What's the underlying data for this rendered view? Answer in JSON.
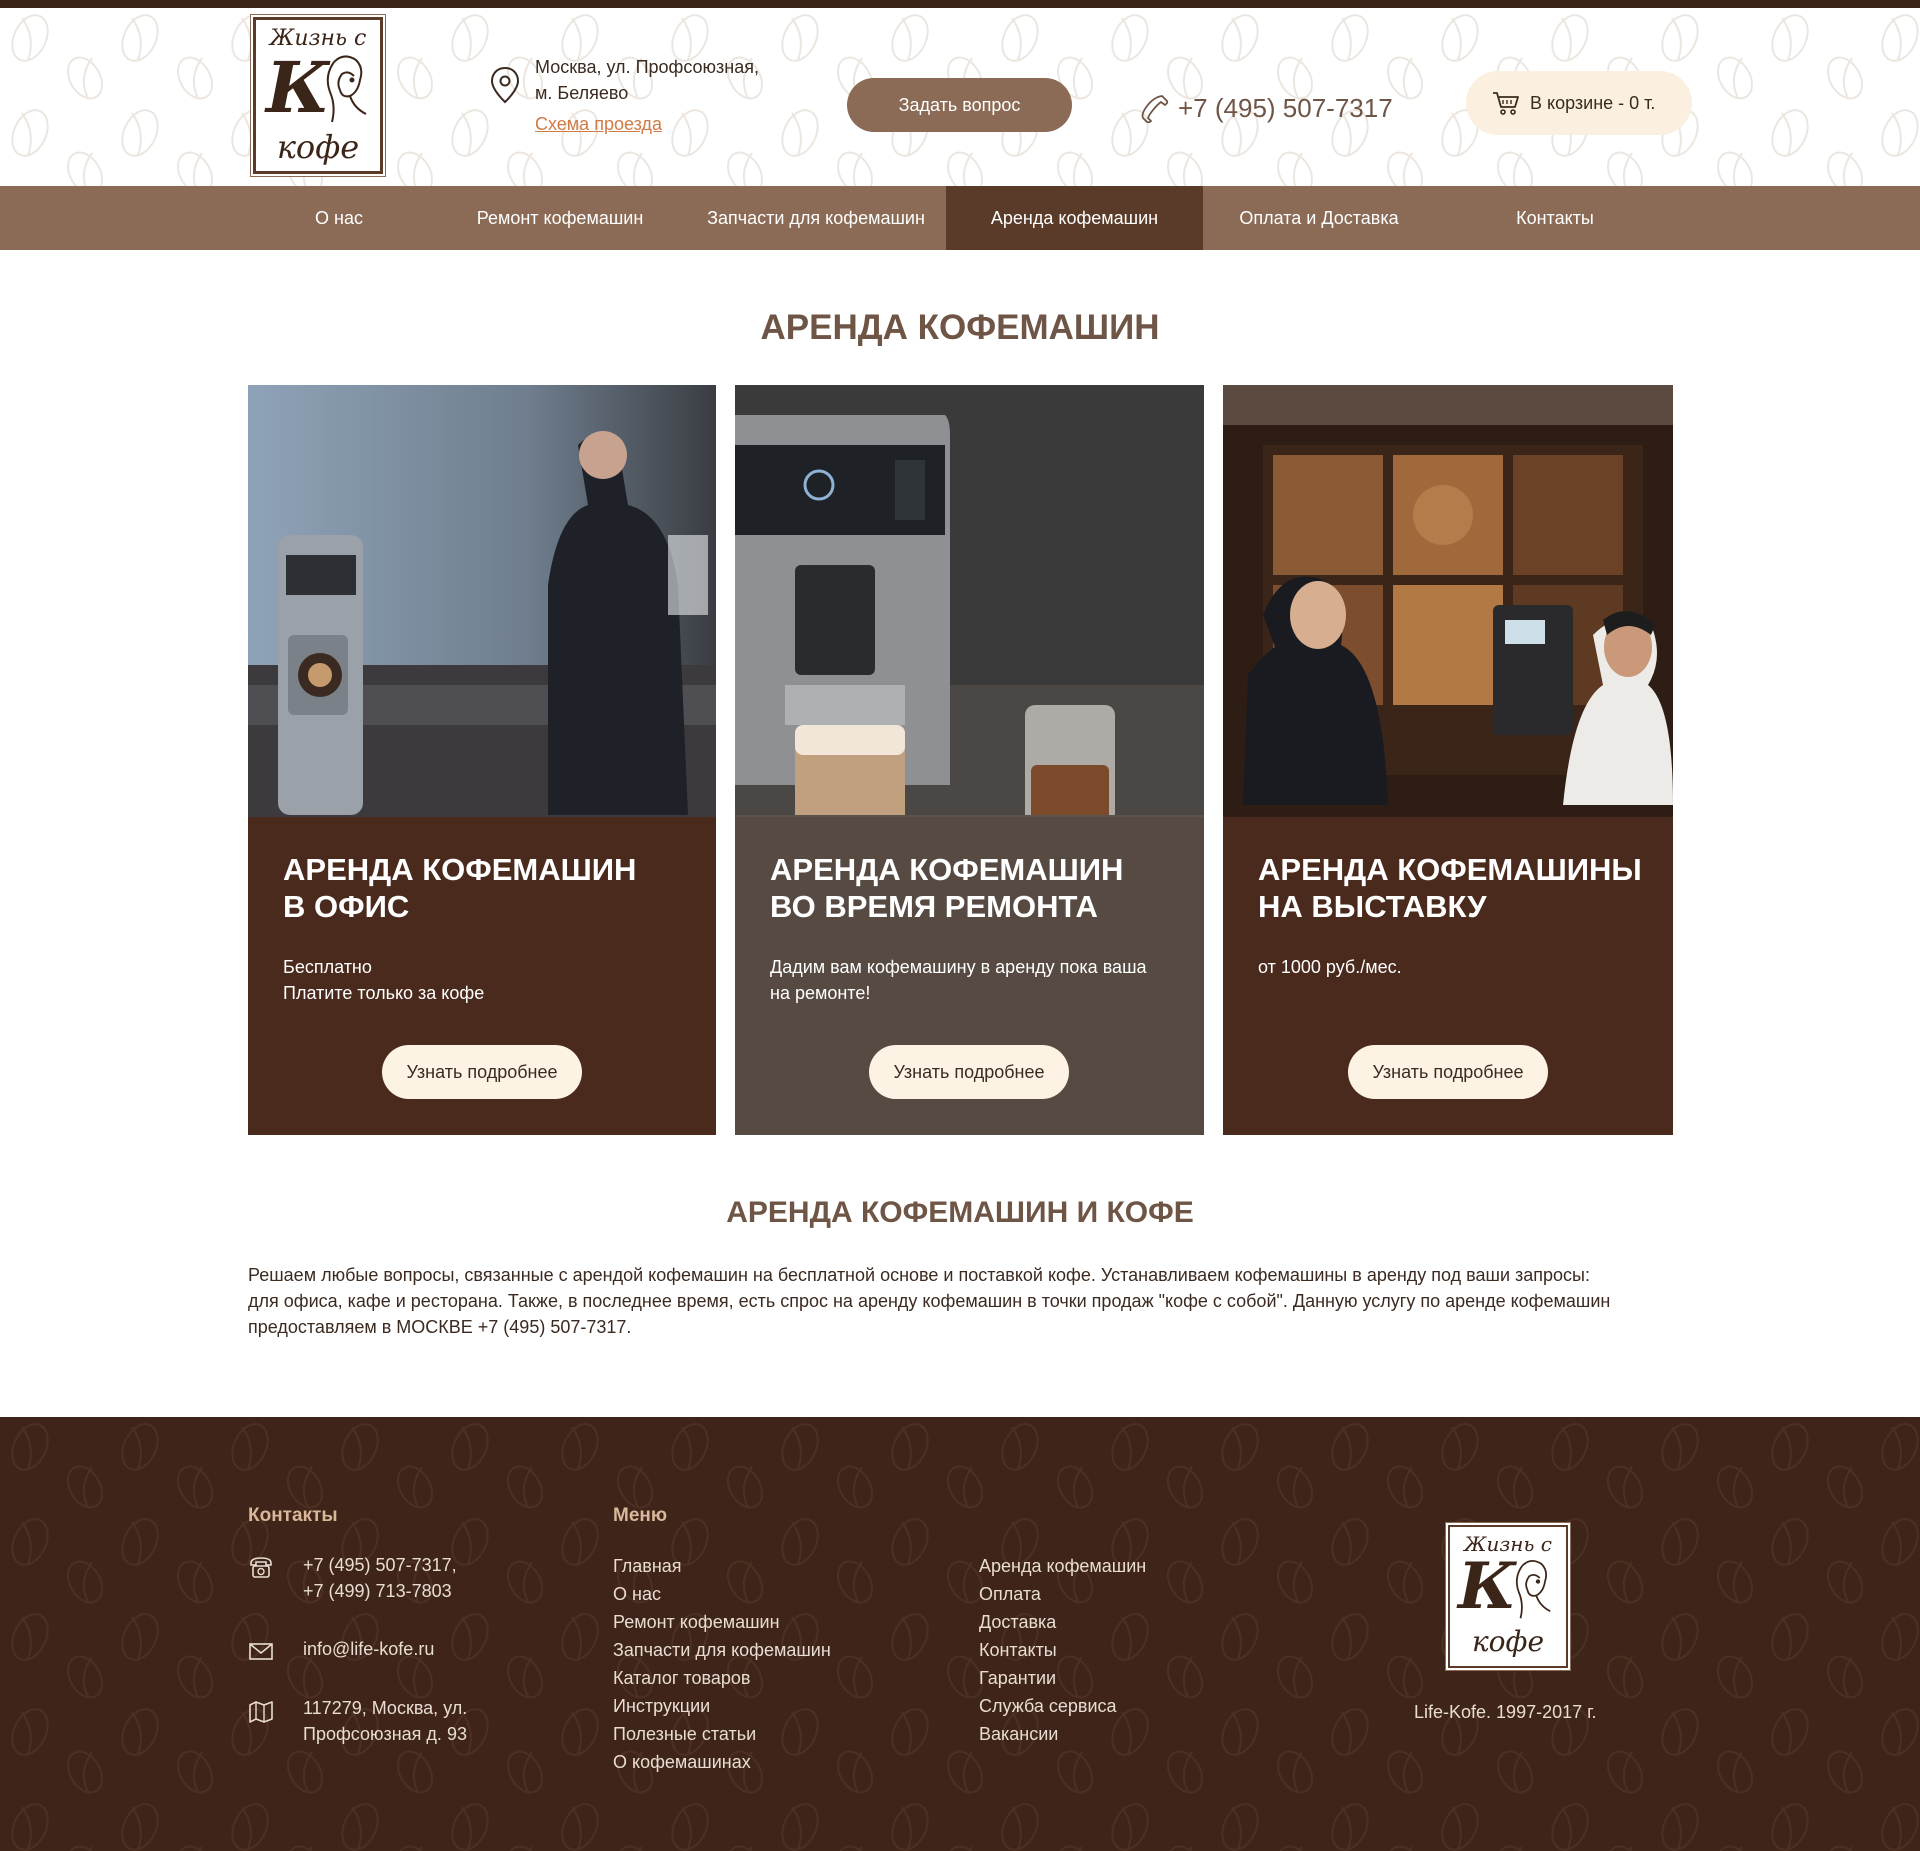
{
  "logo": {
    "line1": "Жизнь с",
    "big_letter": "К",
    "line2": "кофе"
  },
  "header": {
    "address_line1": "Москва, ул. Профсоюзная,",
    "address_line2": "м. Беляево",
    "map_link": "Схема проезда",
    "ask_button": "Задать вопрос",
    "phone": "+7 (495) 507-7317",
    "cart_text": "В корзине - 0 т."
  },
  "nav": {
    "items": [
      {
        "label": "О нас"
      },
      {
        "label": "Ремонт кофемашин"
      },
      {
        "label": "Запчасти для кофемашин"
      },
      {
        "label": "Аренда кофемашин"
      },
      {
        "label": "Оплата и Доставка"
      },
      {
        "label": "Контакты"
      }
    ],
    "active": "Аренда кофемашин"
  },
  "page": {
    "title": "АРЕНДА КОФЕМАШИН"
  },
  "cards": [
    {
      "title_line1": "АРЕНДА КОФЕМАШИН",
      "title_line2": "В ОФИС",
      "desc_line1": "Бесплатно",
      "desc_line2": "Платите только за кофе",
      "button": "Узнать подробнее",
      "image": "office-coffee-machine-photo"
    },
    {
      "title_line1": "АРЕНДА КОФЕМАШИН",
      "title_line2": "ВО ВРЕМЯ РЕМОНТА",
      "desc_line1": "Дадим вам кофемашину в аренду пока ваша",
      "desc_line2": "на ремонте!",
      "button": "Узнать подробнее",
      "image": "espresso-machine-latte-photo"
    },
    {
      "title_line1": "АРЕНДА КОФЕМАШИНЫ",
      "title_line2": "НА ВЫСТАВКУ",
      "desc_line1": "от 1000 руб./мес.",
      "desc_line2": "",
      "button": "Узнать подробнее",
      "image": "exhibition-stand-photo"
    }
  ],
  "section": {
    "title": "АРЕНДА КОФЕМАШИН И КОФЕ",
    "line1": "Решаем любые вопросы, связанные с арендой кофемашин на бесплатной основе и поставкой кофе. Устанавливаем кофемашины в аренду под ваши запросы:",
    "line2": "для офиса, кафе и ресторана. Также, в последнее время, есть спрос на аренду кофемашин в точки продаж \"кофе с собой\". Данную услугу по аренде кофемашин",
    "line3": "предоставляем в МОСКВЕ +7 (495) 507-7317."
  },
  "footer": {
    "contacts_heading": "Контакты",
    "phone_line1": "+7 (495) 507-7317,",
    "phone_line2": "+7 (499) 713-7803",
    "email": "info@life-kofe.ru",
    "address_line1": "117279, Москва, ул.",
    "address_line2": "Профсоюзная д. 93",
    "menu_heading": "Меню",
    "menu_col1": [
      "Главная",
      "О нас",
      "Ремонт кофемашин",
      "Запчасти для кофемашин",
      "Каталог товаров",
      "Инструкции",
      "Полезные статьи",
      "О кофемашинах"
    ],
    "menu_col2": [
      "Аренда кофемашин",
      "Оплата",
      "Доставка",
      "Контакты",
      "Гарантии",
      "Служба сервиса",
      "Вакансии"
    ],
    "copyright": "Life-Kofe. 1997-2017 г."
  },
  "icons": {
    "location": "map-pin-icon",
    "phone": "phone-handset-icon",
    "cart": "shopping-cart-icon",
    "footer_phone": "telephone-icon",
    "footer_email": "envelope-icon",
    "footer_address": "map-icon"
  },
  "colors": {
    "brand_brown": "#8b6b55",
    "dark_brown": "#3e2419",
    "active_nav": "#5a3a28",
    "link_orange": "#d07a46",
    "cart_bg": "#fbf0df"
  }
}
